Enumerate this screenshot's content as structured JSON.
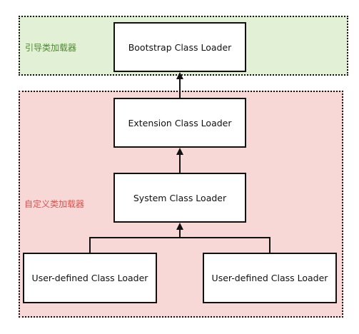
{
  "regions": {
    "builtin_label": "引导类加载器",
    "custom_label": "自定义类加载器"
  },
  "nodes": {
    "bootstrap": "Bootstrap Class Loader",
    "extension": "Extension Class Loader",
    "system": "System Class Loader",
    "user_defined_left": "User-defined Class Loader",
    "user_defined_right": "User-defined Class Loader"
  },
  "edges": [
    {
      "from": "extension",
      "to": "bootstrap"
    },
    {
      "from": "system",
      "to": "extension"
    },
    {
      "from": "user_defined_left",
      "to": "system"
    },
    {
      "from": "user_defined_right",
      "to": "system"
    }
  ],
  "colors": {
    "green_region": "#e2f0d6",
    "green_label": "#4f8a2e",
    "red_region": "#f8d8d7",
    "red_label": "#d9534f"
  }
}
